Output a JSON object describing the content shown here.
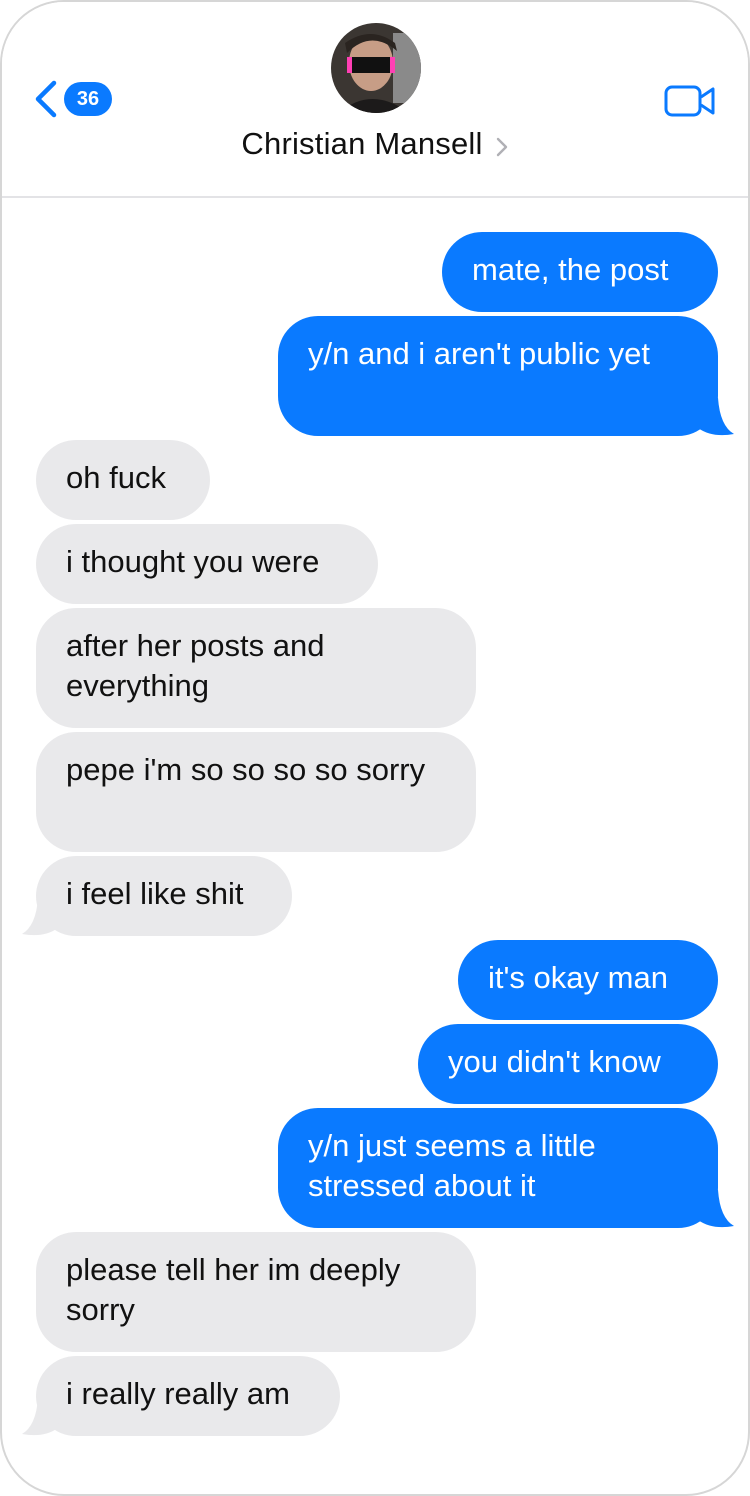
{
  "header": {
    "back_count": "36",
    "contact_name": "Christian Mansell",
    "icons": {
      "back": "chevron-left-icon",
      "contact_chevron": "chevron-right-icon",
      "video": "video-camera-icon"
    }
  },
  "colors": {
    "sent_bubble": "#0a7aff",
    "received_bubble": "#e9e9eb",
    "accent": "#0a7aff"
  },
  "messages": [
    {
      "from": "me",
      "text": "mate, the post"
    },
    {
      "from": "me",
      "text": "y/n and i aren't public yet"
    },
    {
      "from": "them",
      "text": "oh fuck"
    },
    {
      "from": "them",
      "text": "i thought you were"
    },
    {
      "from": "them",
      "text": "after her posts and everything"
    },
    {
      "from": "them",
      "text": "pepe i'm so so so so sorry"
    },
    {
      "from": "them",
      "text": "i feel like shit"
    },
    {
      "from": "me",
      "text": "it's okay man"
    },
    {
      "from": "me",
      "text": "you didn't know"
    },
    {
      "from": "me",
      "text": "y/n just seems a little stressed about it"
    },
    {
      "from": "them",
      "text": "please tell her im deeply sorry"
    },
    {
      "from": "them",
      "text": "i really really am"
    }
  ]
}
